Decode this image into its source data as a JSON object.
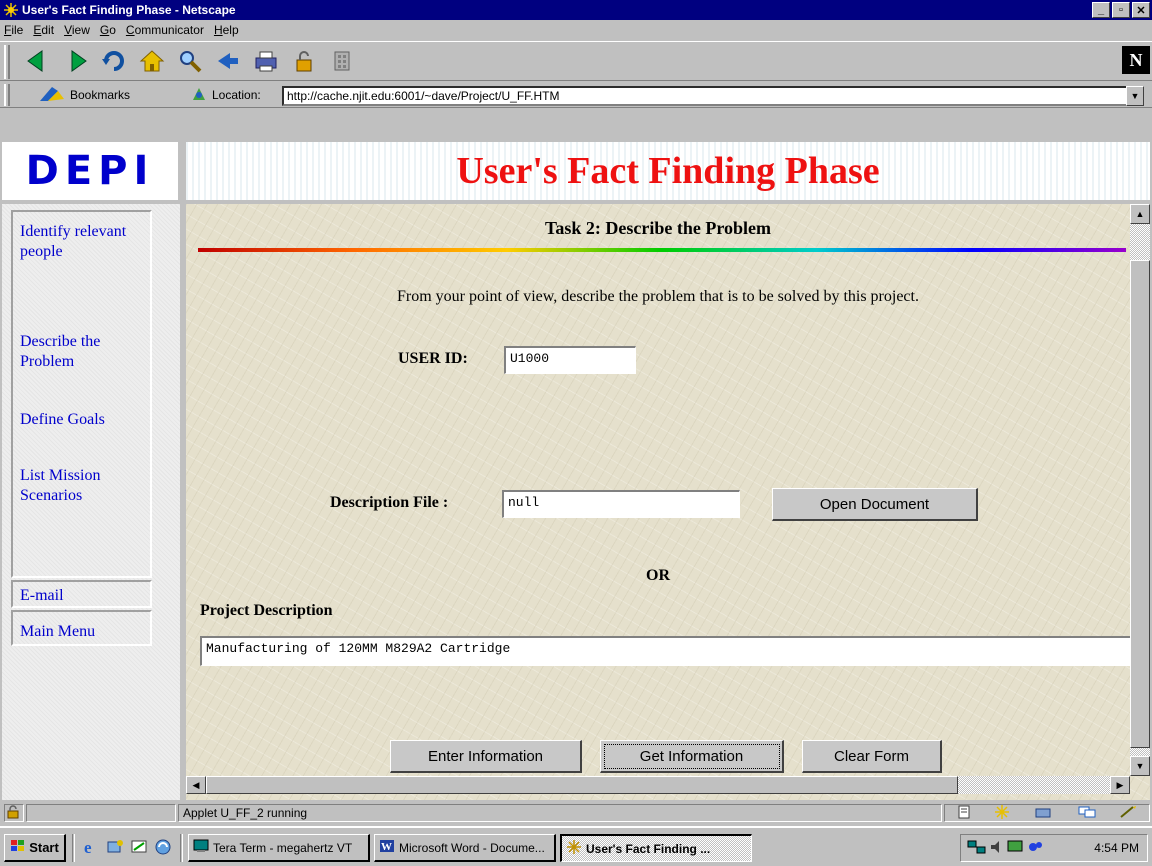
{
  "window": {
    "title": "User's Fact Finding Phase - Netscape",
    "controls": [
      "minimize",
      "maximize",
      "close"
    ]
  },
  "menu": [
    "File",
    "Edit",
    "View",
    "Go",
    "Communicator",
    "Help"
  ],
  "toolbar": {
    "buttons": [
      "back-icon",
      "forward-icon",
      "reload-icon",
      "home-icon",
      "search-icon",
      "guide-icon",
      "print-icon",
      "security-icon",
      "stop-icon"
    ],
    "brand": "N"
  },
  "location_bar": {
    "bookmarks_label": "Bookmarks",
    "location_label": "Location:",
    "url": "http://cache.njit.edu:6001/~dave/Project/U_FF.HTM"
  },
  "logo_frame": {
    "logo_text": "DEPI"
  },
  "header_frame": {
    "title": "User's Fact Finding Phase"
  },
  "nav": {
    "links": [
      {
        "label": "Identify relevant people"
      },
      {
        "label": "Describe the Problem"
      },
      {
        "label": "Define Goals"
      },
      {
        "label": "List Mission Scenarios"
      }
    ],
    "email": "E-mail",
    "main_menu": "Main Menu"
  },
  "content": {
    "task_title": "Task 2: Describe the Problem",
    "instruction": "From your point of view, describe the problem that is to be solved by this project.",
    "user_id_label": "USER ID:",
    "user_id_value": "U1000",
    "description_file_label": "Description File :",
    "description_file_value": "null",
    "open_document_label": "Open Document",
    "or_label": "OR",
    "project_description_label": "Project Description",
    "project_description_value": "Manufacturing of 120MM M829A2 Cartridge",
    "enter_label": "Enter Information",
    "get_label": "Get Information",
    "clear_label": "Clear Form"
  },
  "status": {
    "text": "Applet U_FF_2 running"
  },
  "taskbar": {
    "start_label": "Start",
    "tasks": [
      {
        "label": "Tera Term - megahertz VT"
      },
      {
        "label": "Microsoft Word - Docume..."
      },
      {
        "label": "User's Fact Finding ..."
      }
    ],
    "clock": "4:54 PM"
  },
  "colors": {
    "title_bar": "#000080",
    "header_title": "#ee1111",
    "nav_link": "#0000cc",
    "logo": "#0000cc"
  }
}
